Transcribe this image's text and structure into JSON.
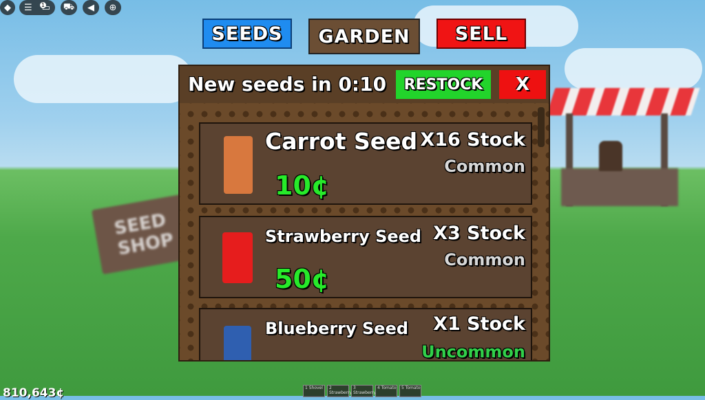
{
  "roblox_topbar": {
    "icons": [
      "roblox-logo-icon",
      "menu-icon",
      "chat-icon",
      "cart-icon",
      "mute-icon",
      "backpack-icon"
    ],
    "chat_badge": "1"
  },
  "nav": {
    "seeds_label": "SEEDS",
    "garden_label": "GARDEN",
    "sell_label": "SELL",
    "colors": {
      "seeds": "#1f8cf0",
      "garden": "#6b4e34",
      "sell": "#f01414"
    }
  },
  "shop": {
    "timer_text": "New seeds in 0:10",
    "restock_label": "RESTOCK",
    "close_label": "X",
    "items": [
      {
        "name": "Carrot Seed",
        "stock": "X16 Stock",
        "rarity": "Common",
        "price": "10¢",
        "color": "#d8783e"
      },
      {
        "name": "Strawberry Seed",
        "stock": "X3 Stock",
        "rarity": "Common",
        "price": "50¢",
        "color": "#e61d1d"
      },
      {
        "name": "Blueberry Seed",
        "stock": "X1 Stock",
        "rarity": "Uncommon",
        "price": "",
        "color": "#2f5fb0"
      }
    ],
    "rarity_colors": {
      "Common": "#d8d8d8",
      "Uncommon": "#31d04a"
    }
  },
  "background_sign": "SEED SHOP",
  "hotbar": [
    "1 Shovel",
    "2 Strawberry",
    "3 Strawberry",
    "4 Tomato",
    "5 Tomato"
  ],
  "money": "810,643¢"
}
